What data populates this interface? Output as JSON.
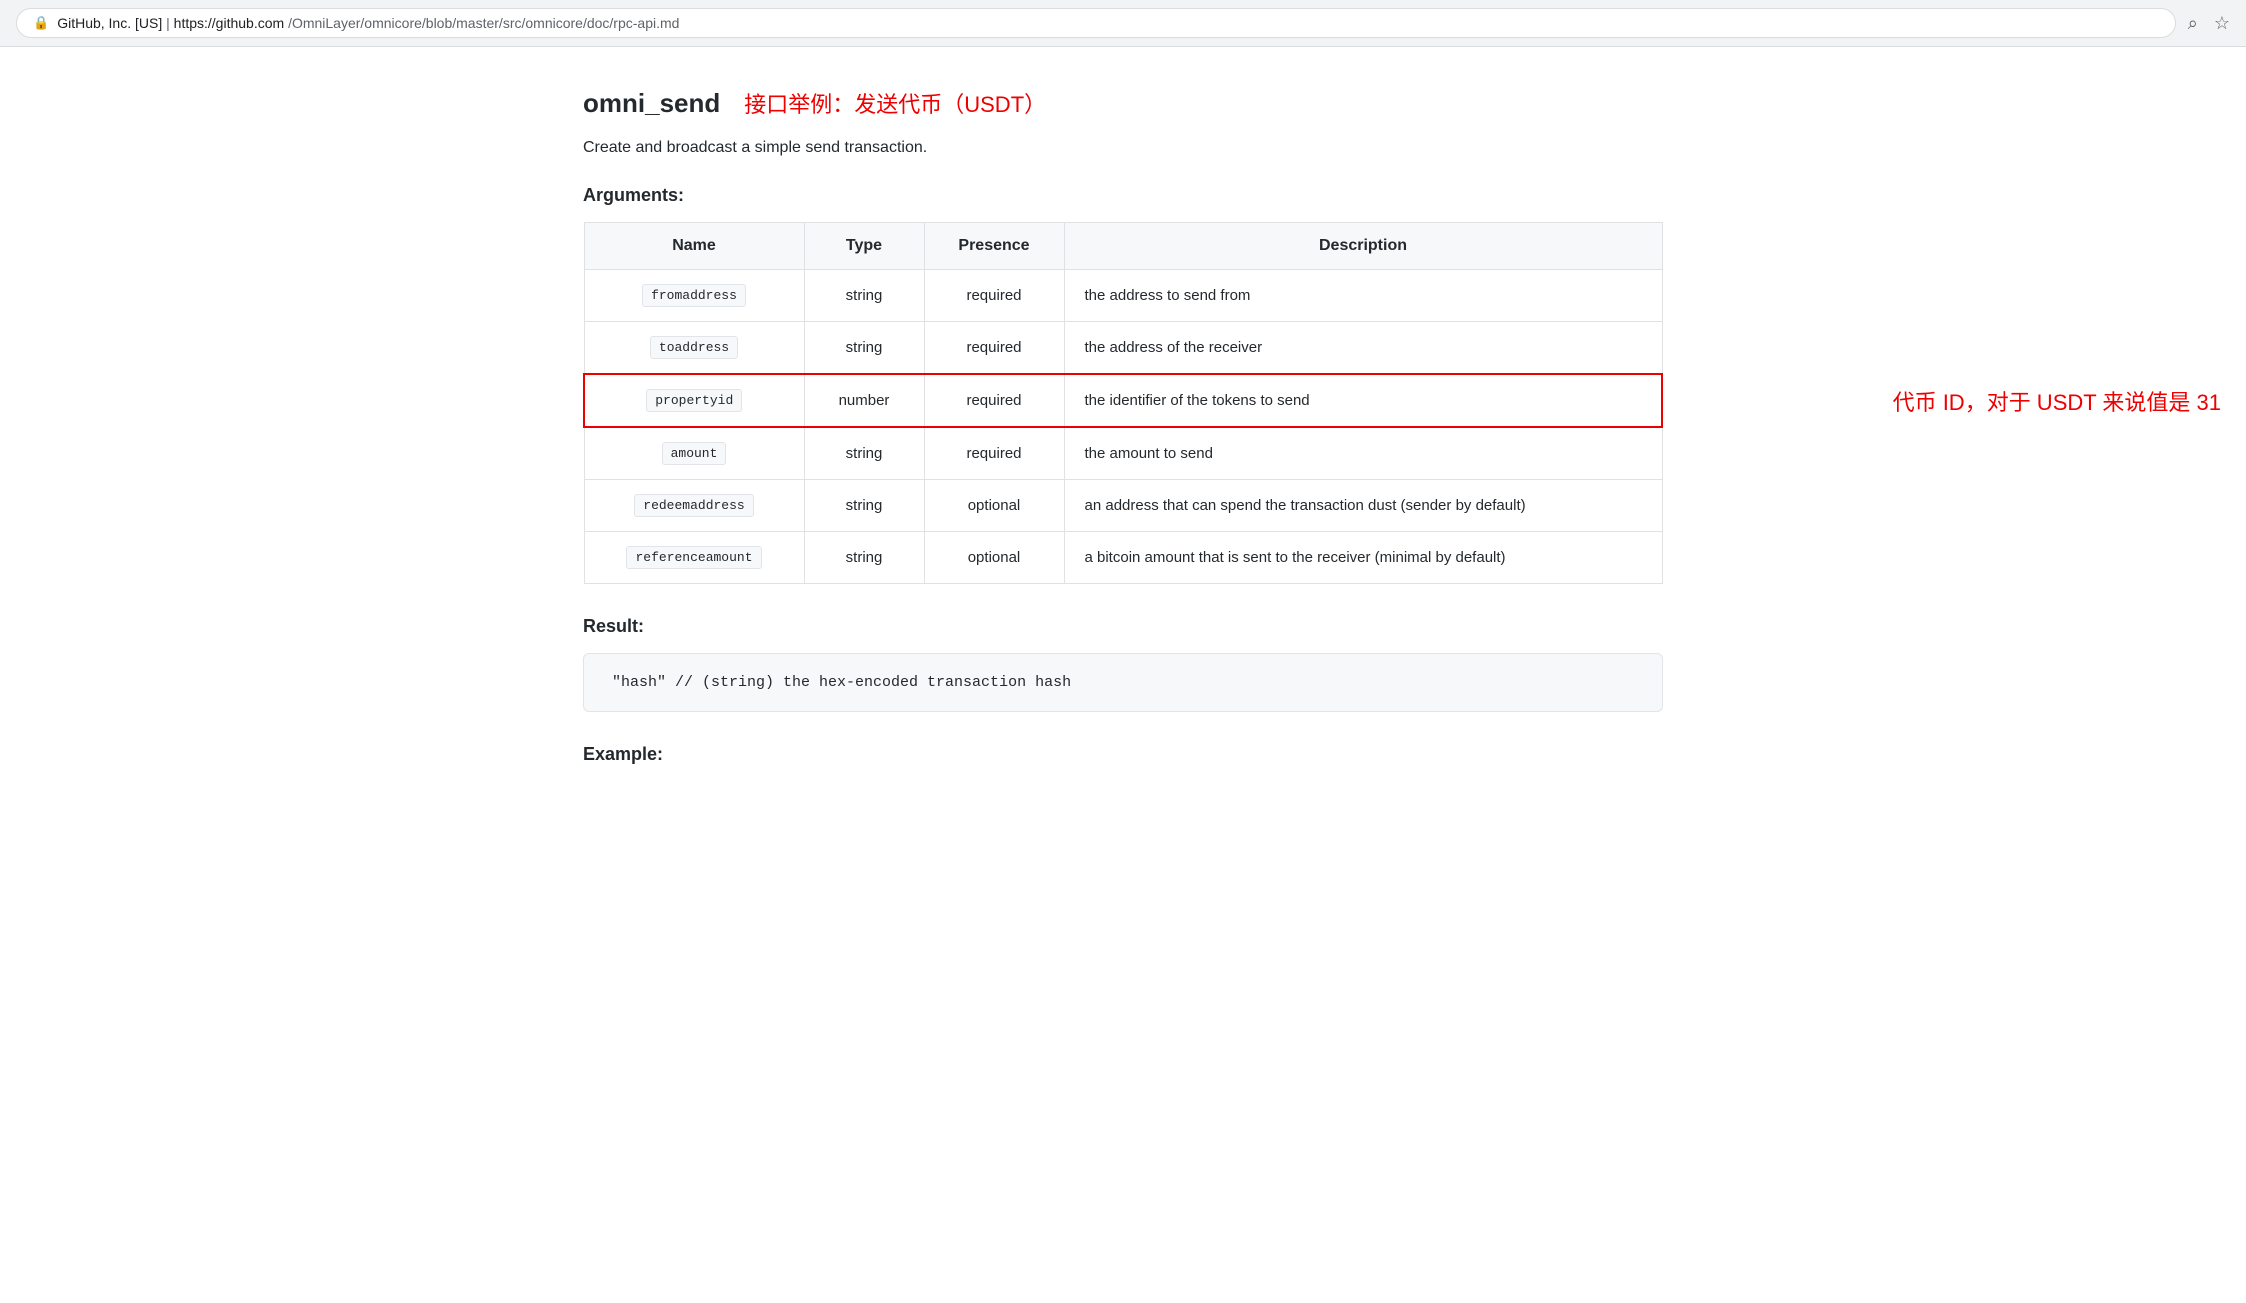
{
  "browser": {
    "lock_icon": "🔒",
    "company": "GitHub, Inc. [US]",
    "url_host": "https://github.com",
    "url_path": "/OmniLayer/omnicore/blob/master/src/omnicore/doc/rpc-api.md",
    "search_icon": "⌕",
    "bookmark_icon": "☆"
  },
  "page": {
    "api_name": "omni_send",
    "title_annotation": "接口举例：发送代币（USDT）",
    "description": "Create and broadcast a simple send transaction.",
    "arguments_label": "Arguments:",
    "table": {
      "headers": {
        "name": "Name",
        "type": "Type",
        "presence": "Presence",
        "description": "Description"
      },
      "rows": [
        {
          "name": "fromaddress",
          "type": "string",
          "presence": "required",
          "description": "the address to send from",
          "highlighted": false
        },
        {
          "name": "toaddress",
          "type": "string",
          "presence": "required",
          "description": "the address of the receiver",
          "highlighted": false
        },
        {
          "name": "propertyid",
          "type": "number",
          "presence": "required",
          "description": "the identifier of the tokens to send",
          "highlighted": true,
          "annotation": "代币 ID，对于 USDT 来说值是 31"
        },
        {
          "name": "amount",
          "type": "string",
          "presence": "required",
          "description": "the amount to send",
          "highlighted": false
        },
        {
          "name": "redeemaddress",
          "type": "string",
          "presence": "optional",
          "description": "an address that can spend the transaction dust (sender by default)",
          "highlighted": false
        },
        {
          "name": "referenceamount",
          "type": "string",
          "presence": "optional",
          "description": "a bitcoin amount that is sent to the receiver (minimal by default)",
          "highlighted": false
        }
      ]
    },
    "result_label": "Result:",
    "result_code": "\"hash\"  // (string) the hex-encoded transaction hash",
    "example_label": "Example:"
  }
}
